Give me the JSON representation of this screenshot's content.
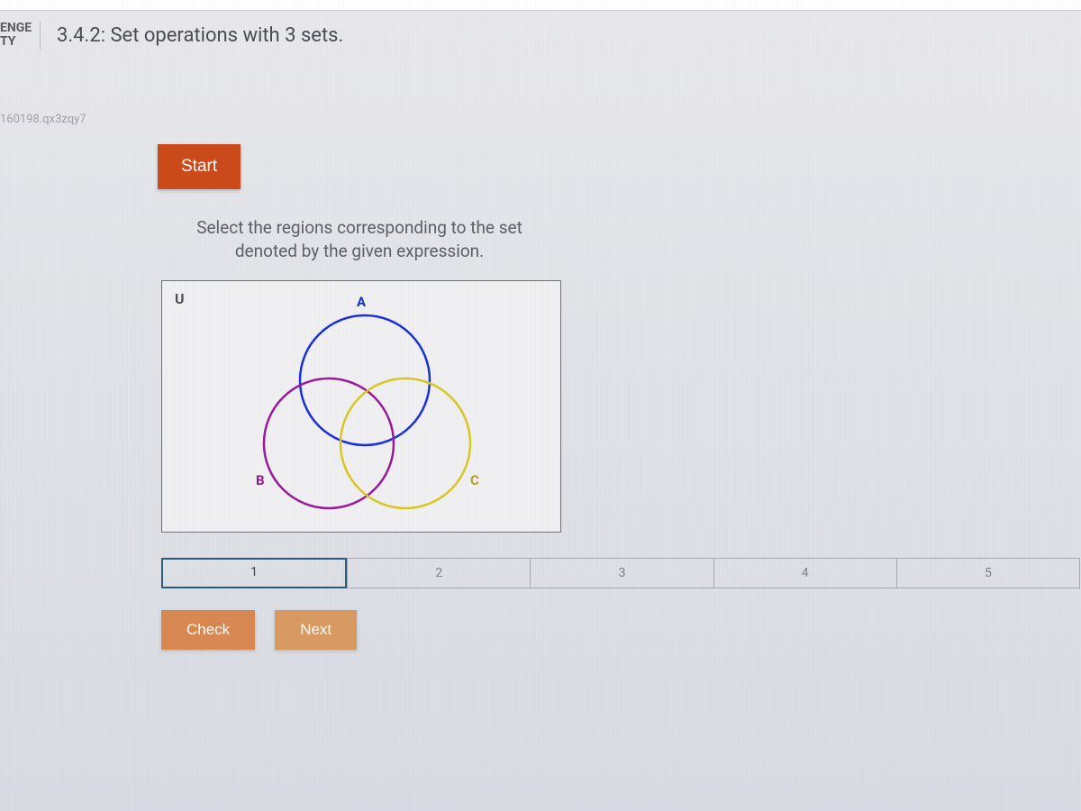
{
  "header": {
    "side_label_line1": "ENGE",
    "side_label_line2": "TY",
    "title": "3.4.2: Set operations with 3 sets."
  },
  "reference_code": "160198.qx3zqy7",
  "activity": {
    "start_label": "Start",
    "instruction_line1": "Select the regions corresponding to the set",
    "instruction_line2": "denoted by the given expression.",
    "venn": {
      "universe_label": "U",
      "set_a_label": "A",
      "set_b_label": "B",
      "set_c_label": "C",
      "colors": {
        "a": "#1a30d8",
        "b": "#9a1a9a",
        "c": "#d8c820"
      }
    },
    "steps": [
      "1",
      "2",
      "3",
      "4",
      "5"
    ],
    "active_step_index": 0,
    "check_label": "Check",
    "next_label": "Next"
  }
}
